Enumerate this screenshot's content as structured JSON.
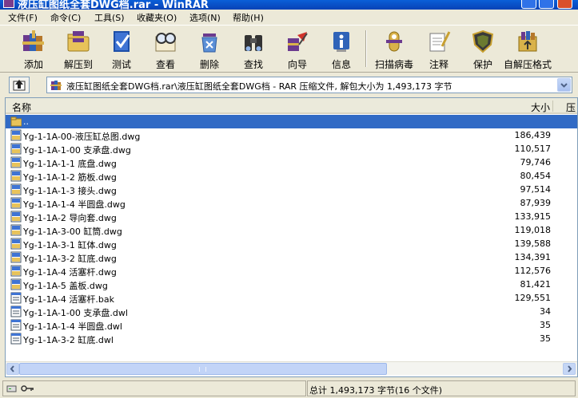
{
  "window": {
    "title": "液压缸图纸全套DWG档.rar - WinRAR"
  },
  "menu": [
    {
      "label": "文件(F)"
    },
    {
      "label": "命令(C)"
    },
    {
      "label": "工具(S)"
    },
    {
      "label": "收藏夹(O)"
    },
    {
      "label": "选项(N)"
    },
    {
      "label": "帮助(H)"
    }
  ],
  "toolbar": [
    {
      "label": "添加",
      "icon": "add-books-icon"
    },
    {
      "label": "解压到",
      "icon": "extract-folder-icon"
    },
    {
      "label": "测试",
      "icon": "test-checkbook-icon"
    },
    {
      "label": "查看",
      "icon": "view-glasses-icon"
    },
    {
      "label": "删除",
      "icon": "delete-recycle-icon"
    },
    {
      "label": "查找",
      "icon": "find-binoculars-icon"
    },
    {
      "label": "向导",
      "icon": "wizard-icon"
    },
    {
      "label": "信息",
      "icon": "info-icon"
    },
    {
      "label": "扫描病毒",
      "icon": "virus-scan-icon"
    },
    {
      "label": "注释",
      "icon": "comment-icon"
    },
    {
      "label": "保护",
      "icon": "protect-shield-icon"
    },
    {
      "label": "自解压格式",
      "icon": "sfx-icon"
    }
  ],
  "pathbar": {
    "path": "液压缸图纸全套DWG档.rar\\液压缸图纸全套DWG档 - RAR 压缩文件, 解包大小为 1,493,173 字节"
  },
  "columns": {
    "name": "名称",
    "size": "大小",
    "packed": "压"
  },
  "files": [
    {
      "name": "..",
      "size": "",
      "type": "folder-up",
      "selected": true
    },
    {
      "name": "Yg-1-1A-00-液压缸总图.dwg",
      "size": "186,439",
      "type": "dwg"
    },
    {
      "name": "Yg-1-1A-1-00 支承盘.dwg",
      "size": "110,517",
      "type": "dwg"
    },
    {
      "name": "Yg-1-1A-1-1 底盘.dwg",
      "size": "79,746",
      "type": "dwg"
    },
    {
      "name": "Yg-1-1A-1-2 筋板.dwg",
      "size": "80,454",
      "type": "dwg"
    },
    {
      "name": "Yg-1-1A-1-3 接头.dwg",
      "size": "97,514",
      "type": "dwg"
    },
    {
      "name": "Yg-1-1A-1-4 半圆盘.dwg",
      "size": "87,939",
      "type": "dwg"
    },
    {
      "name": "Yg-1-1A-2 导向套.dwg",
      "size": "133,915",
      "type": "dwg"
    },
    {
      "name": "Yg-1-1A-3-00 缸筒.dwg",
      "size": "119,018",
      "type": "dwg"
    },
    {
      "name": "Yg-1-1A-3-1 缸体.dwg",
      "size": "139,588",
      "type": "dwg"
    },
    {
      "name": "Yg-1-1A-3-2 缸底.dwg",
      "size": "134,391",
      "type": "dwg"
    },
    {
      "name": "Yg-1-1A-4 活塞杆.dwg",
      "size": "112,576",
      "type": "dwg"
    },
    {
      "name": "Yg-1-1A-5 盖板.dwg",
      "size": "81,421",
      "type": "dwg"
    },
    {
      "name": "Yg-1-1A-4 活塞杆.bak",
      "size": "129,551",
      "type": "bak"
    },
    {
      "name": "Yg-1-1A-1-00 支承盘.dwl",
      "size": "34",
      "type": "dwl"
    },
    {
      "name": "Yg-1-1A-1-4 半圆盘.dwl",
      "size": "35",
      "type": "dwl"
    },
    {
      "name": "Yg-1-1A-3-2 缸底.dwl",
      "size": "35",
      "type": "dwl"
    }
  ],
  "statusbar": {
    "right_text": "总计 1,493,173 字节(16 个文件)"
  },
  "colors": {
    "selection": "#316ac5",
    "title_blue": "#0a5fd8",
    "chrome": "#ece9d8"
  }
}
